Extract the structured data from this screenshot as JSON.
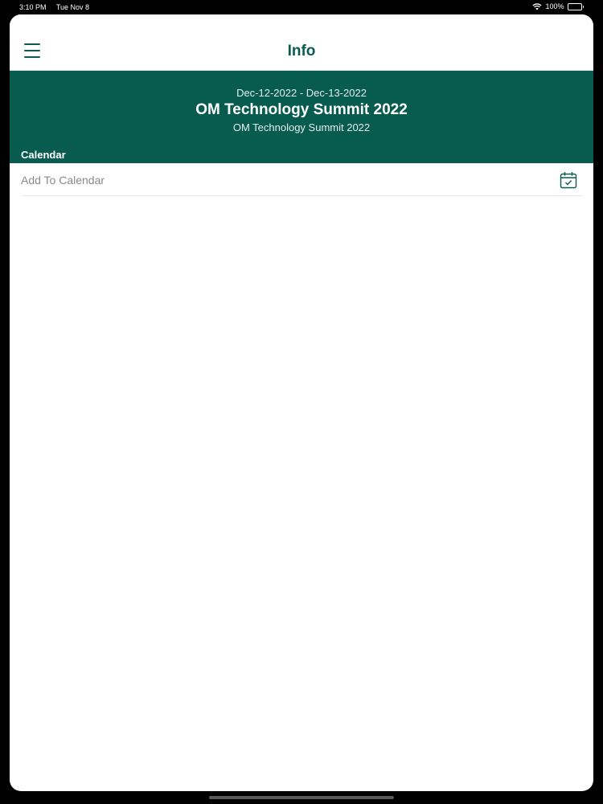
{
  "status_bar": {
    "time": "3:10 PM",
    "date": "Tue Nov 8",
    "battery": "100%"
  },
  "nav": {
    "title": "Info",
    "menu_icon": "hamburger-menu-icon"
  },
  "event": {
    "dates": "Dec-12-2022 - Dec-13-2022",
    "title": "OM Technology Summit 2022",
    "subtitle": "OM Technology Summit 2022",
    "section_label": "Calendar"
  },
  "calendar": {
    "add_label": "Add To Calendar",
    "icon": "calendar-check-icon"
  },
  "colors": {
    "brand": "#075b4f",
    "nav_title": "#0a5b50"
  }
}
